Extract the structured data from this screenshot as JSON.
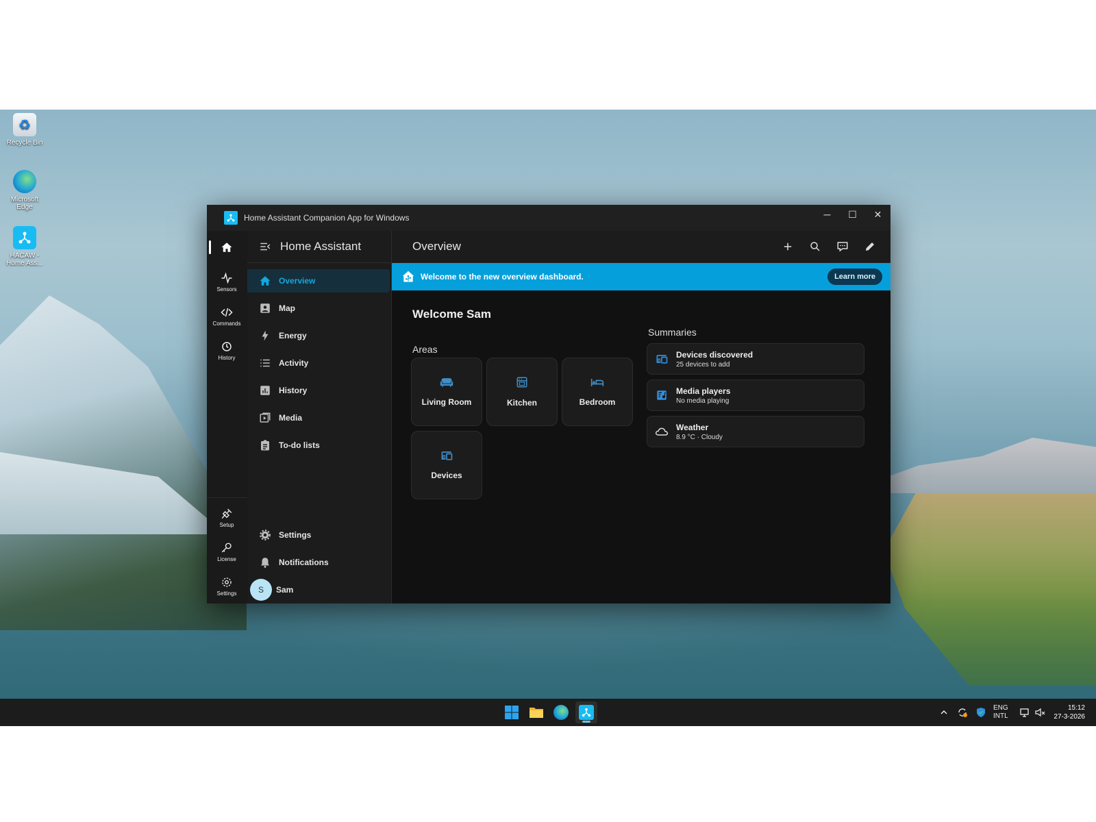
{
  "desktop": {
    "icons": [
      {
        "label": "Recycle Bin"
      },
      {
        "label": "Microsoft Edge"
      },
      {
        "label": "HACAW - Home Ass..."
      }
    ]
  },
  "window": {
    "title": "Home Assistant Companion App for Windows",
    "controls": {
      "minimize": "─",
      "maximize": "☐",
      "close": "✕"
    }
  },
  "rail": {
    "top": [
      {
        "label": "",
        "icon": "home-icon"
      },
      {
        "label": "Sensors",
        "icon": "pulse-icon"
      },
      {
        "label": "Commands",
        "icon": "code-icon"
      },
      {
        "label": "History",
        "icon": "history-icon"
      }
    ],
    "bottom": [
      {
        "label": "Setup",
        "icon": "plug-icon"
      },
      {
        "label": "License",
        "icon": "key-icon"
      },
      {
        "label": "Settings",
        "icon": "gear-icon"
      }
    ]
  },
  "sidebar": {
    "brand": "Home Assistant",
    "items": [
      {
        "label": "Overview",
        "icon": "home-icon",
        "active": true
      },
      {
        "label": "Map",
        "icon": "map-icon"
      },
      {
        "label": "Energy",
        "icon": "lightning-icon"
      },
      {
        "label": "Activity",
        "icon": "list-icon"
      },
      {
        "label": "History",
        "icon": "chart-icon"
      },
      {
        "label": "Media",
        "icon": "media-icon"
      },
      {
        "label": "To-do lists",
        "icon": "clipboard-icon"
      }
    ],
    "bottom": {
      "settings": "Settings",
      "notifications": "Notifications",
      "user": "Sam",
      "avatar_letter": "S"
    }
  },
  "main": {
    "title": "Overview",
    "banner": {
      "text": "Welcome to the new overview dashboard.",
      "button": "Learn more",
      "color": "#05a0dc"
    },
    "welcome": "Welcome Sam",
    "areas_label": "Areas",
    "areas": [
      {
        "name": "Living Room",
        "icon": "sofa-icon"
      },
      {
        "name": "Kitchen",
        "icon": "stove-icon"
      },
      {
        "name": "Bedroom",
        "icon": "bed-icon"
      },
      {
        "name": "Devices",
        "icon": "devices-icon"
      }
    ],
    "summaries_label": "Summaries",
    "summaries": [
      {
        "title": "Devices discovered",
        "subtitle": "25 devices to add",
        "icon": "devices-icon"
      },
      {
        "title": "Media players",
        "subtitle": "No media playing",
        "icon": "media-player-icon"
      },
      {
        "title": "Weather",
        "subtitle": "8.9 °C · Cloudy",
        "icon": "cloud-icon"
      }
    ]
  },
  "taskbar": {
    "tray": {
      "lang1": "ENG",
      "lang2": "INTL"
    },
    "clock": {
      "time": "15:12",
      "date": "27-3-2026"
    }
  }
}
